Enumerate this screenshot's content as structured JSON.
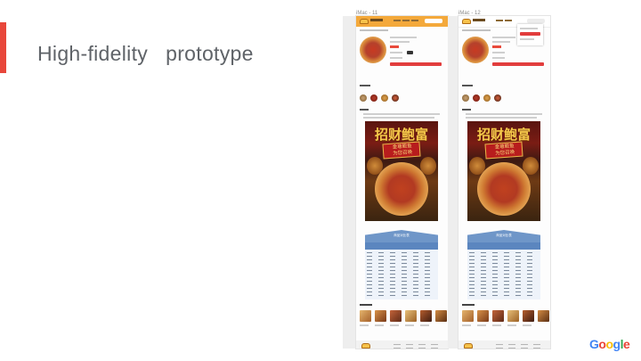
{
  "slide": {
    "title": "High-fidelity   prototype",
    "accent_color": "#e8473b"
  },
  "frames": [
    {
      "label": "iMac - 11",
      "poster_title": "招财鲍富",
      "poster_sub": "金尊鲍鱼\n为您召唤",
      "table_title": "商品对比表"
    },
    {
      "label": "iMac - 12",
      "poster_title": "招财鲍富",
      "poster_sub": "金尊鲍鱼\n为您召唤",
      "table_title": "商品对比表"
    }
  ],
  "brand": {
    "letters": [
      "G",
      "o",
      "o",
      "g",
      "l",
      "e"
    ],
    "colors": [
      "#4285f4",
      "#ea4335",
      "#fbbc05",
      "#4285f4",
      "#34a853",
      "#ea4335"
    ]
  },
  "colors": {
    "header": "#f4a93b",
    "cta": "#e23d3d",
    "table": "#6f96c8"
  }
}
